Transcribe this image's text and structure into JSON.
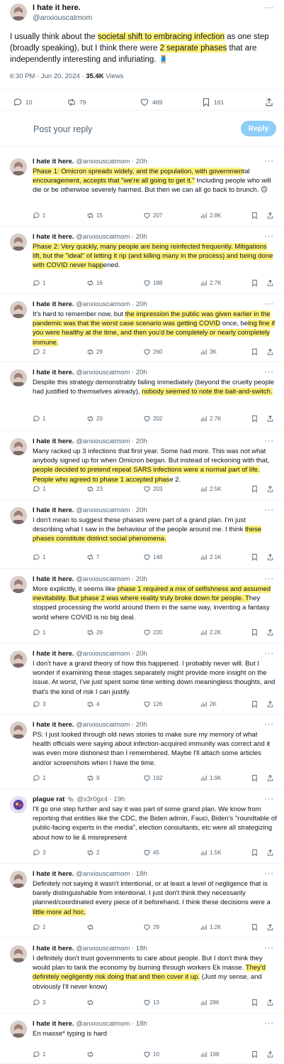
{
  "main": {
    "name": "I hate it here.",
    "handle": "@anxiouscatmom",
    "text_parts": [
      {
        "t": "I usually think about the ",
        "hl": false
      },
      {
        "t": "societal shift to embracing infection",
        "hl": true
      },
      {
        "t": " as one step (broadly speaking), but I think there were ",
        "hl": false
      },
      {
        "t": "2 separate phases",
        "hl": true
      },
      {
        "t": " that are independently interesting and infuriating. 🧵",
        "hl": false
      }
    ],
    "time": "6:30 PM · Jun 20, 2024 · ",
    "views_count": "35.4K",
    "views_label": " Views",
    "stats": {
      "replies": "10",
      "reposts": "79",
      "likes": "469",
      "bookmarks": "161"
    }
  },
  "reply_box": {
    "placeholder": "Post your reply",
    "button": "Reply"
  },
  "replies": [
    {
      "name": "I hate it here.",
      "handle": "@anxiouscatmom",
      "time": "20h",
      "parts": [
        {
          "t": "Phase 1: Omicron spreads widely, and the population, with governmen",
          "hl": true
        },
        {
          "t": "tal ",
          "hl": false
        },
        {
          "t": "encouragement, accepts that \"we're all going to get it.\"",
          "hl": true
        },
        {
          "t": " Including people who will die or be otherwise severely harmed. But then we can all go back to brunch. 🙃",
          "hl": false
        }
      ],
      "stats": [
        "1",
        "15",
        "207",
        "2.8K"
      ]
    },
    {
      "name": "I hate it here.",
      "handle": "@anxiouscatmom",
      "time": "20h",
      "parts": [
        {
          "t": "Phase 2: Very quickly, many people are being reinfected frequently. Mitigations lift, but the \"ideal\" of letting it rip (and killing many in the process) and being done with COVID never happ",
          "hl": true
        },
        {
          "t": "ened.",
          "hl": false
        }
      ],
      "stats": [
        "1",
        "16",
        "188",
        "2.7K"
      ]
    },
    {
      "name": "I hate it here.",
      "handle": "@anxiouscatmom",
      "time": "20h",
      "parts": [
        {
          "t": "It's hard to remember now, but ",
          "hl": false
        },
        {
          "t": "the impression the public was given earlier in the pandemic was that the worst case scenario was getting COVID",
          "hl": true
        },
        {
          "t": " once, be",
          "hl": false
        },
        {
          "t": "ing fine if you were healthy at the time, and then you'd be completely or nearly completely immune.",
          "hl": true
        }
      ],
      "stats": [
        "2",
        "29",
        "260",
        "3K"
      ]
    },
    {
      "name": "I hate it here.",
      "handle": "@anxiouscatmom",
      "time": "20h",
      "parts": [
        {
          "t": "Despite this strategy demonstrably failing immediately (beyond the cruelty people had justified to themselves already), ",
          "hl": false
        },
        {
          "t": "nobody seemed to note the bait-and-switch.",
          "hl": true
        }
      ],
      "stats": [
        "1",
        "20",
        "202",
        "2.7K"
      ]
    },
    {
      "name": "I hate it here.",
      "handle": "@anxiouscatmom",
      "time": "20h",
      "parts": [
        {
          "t": "Many racked up 3 infections that first year. Some had more. This was not what anybody signed up for when Omicron began. But instead of reckoning with that, ",
          "hl": false
        },
        {
          "t": "people decided to pretend repeat SARS infections were a normal part of life. People who agreed to phase 1 accepted phas",
          "hl": true
        },
        {
          "t": "e 2.",
          "hl": false
        }
      ],
      "stats": [
        "1",
        "23",
        "203",
        "2.5K"
      ]
    },
    {
      "name": "I hate it here.",
      "handle": "@anxiouscatmom",
      "time": "20h",
      "parts": [
        {
          "t": "I don't mean to suggest these phases were part of a grand plan. I'm just describing what I saw in the behaviour of the people around me. I think ",
          "hl": false
        },
        {
          "t": "these phases constitute distinct social phenomena.",
          "hl": true
        }
      ],
      "stats": [
        "1",
        "7",
        "148",
        "2.1K"
      ]
    },
    {
      "name": "I hate it here.",
      "handle": "@anxiouscatmom",
      "time": "20h",
      "parts": [
        {
          "t": "More explicitly, it seems like ",
          "hl": false
        },
        {
          "t": "phase 1 required a mix of selfishness and assumed inevitability. But phase 2 was where reality truly broke down for people. T",
          "hl": true
        },
        {
          "t": "hey stopped processing the world around them in the same way, inventing a fantasy world where COVID is no big deal.",
          "hl": false
        }
      ],
      "stats": [
        "1",
        "26",
        "220",
        "2.2K"
      ]
    },
    {
      "name": "I hate it here.",
      "handle": "@anxiouscatmom",
      "time": "20h",
      "parts": [
        {
          "t": "I don't have a grand theory of how this happened. I probably never will. But I wonder if examining these stages separately might provide more insight on the issue. At worst, I've just spent some time writing down meaningless thoughts, and that's the kind of risk I can justify.",
          "hl": false
        }
      ],
      "stats": [
        "3",
        "4",
        "126",
        "2K"
      ]
    },
    {
      "name": "I hate it here.",
      "handle": "@anxiouscatmom",
      "time": "20h",
      "parts": [
        {
          "t": "PS: I just looked through old news stories to make sure my memory of what health officials were saying about infection-acquired immunity was correct and it was even more dishonest than I remembered. Maybe I'll attach some articles and/or screenshots when I have the time.",
          "hl": false
        }
      ],
      "stats": [
        "1",
        "9",
        "192",
        "1.9K"
      ]
    },
    {
      "name": "plague rat 🐀",
      "handle": "@x3r0gx4",
      "time": "19h",
      "rat": true,
      "parts": [
        {
          "t": "I'll go one step further and say it was part of some grand plan. We know from reporting that entities like the CDC, the Biden admin, Fauci, Biden's \"roundtable of public-facing experts in the media\", election consultants, etc were all strategizing about how to lie & misrepresent",
          "hl": false
        }
      ],
      "stats": [
        "3",
        "2",
        "45",
        "1.5K"
      ]
    },
    {
      "name": "I hate it here.",
      "handle": "@anxiouscatmom",
      "time": "18h",
      "parts": [
        {
          "t": "Definitely not saying it wasn't intentional, or at least a level of negligence that is barely distinguishable from intentional. I just don't think they necessarily planned/coordinated every piece of it beforehand. I think these decisions were a ",
          "hl": false
        },
        {
          "t": "little more ad hoc.",
          "hl": true
        }
      ],
      "stats": [
        "1",
        "",
        "29",
        "1.2K"
      ]
    },
    {
      "name": "I hate it here.",
      "handle": "@anxiouscatmom",
      "time": "18h",
      "parts": [
        {
          "t": "I definitely don't trust governments to care about people. But I don't think they would plan to tank the economy by burning through workers Ek masse. ",
          "hl": false
        },
        {
          "t": "They'd definitely negligently risk doing that and then cover it up.",
          "hl": true
        },
        {
          "t": " (Just my sense, and obviously I'll never know)",
          "hl": false
        }
      ],
      "stats": [
        "3",
        "",
        "13",
        "286"
      ]
    },
    {
      "name": "I hate it here.",
      "handle": "@anxiouscatmom",
      "time": "18h",
      "parts": [
        {
          "t": "En masse* typing is hard",
          "hl": false
        }
      ],
      "stats": [
        "1",
        "",
        "10",
        "198"
      ]
    }
  ]
}
